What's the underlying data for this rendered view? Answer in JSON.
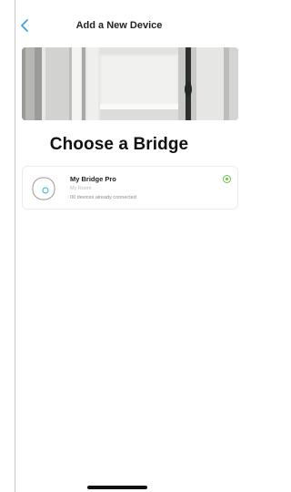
{
  "header": {
    "title": "Add a New Device",
    "back_icon": "chevron-left-icon"
  },
  "main": {
    "heading": "Choose a Bridge",
    "bridges": [
      {
        "name": "My Bridge Pro",
        "room": "My Room",
        "devices": "00 devices already connected",
        "selected": true
      }
    ]
  },
  "colors": {
    "accent": "#3aa4e8",
    "selected": "#6cc04a",
    "bridge_light": "#2bb6d6"
  }
}
